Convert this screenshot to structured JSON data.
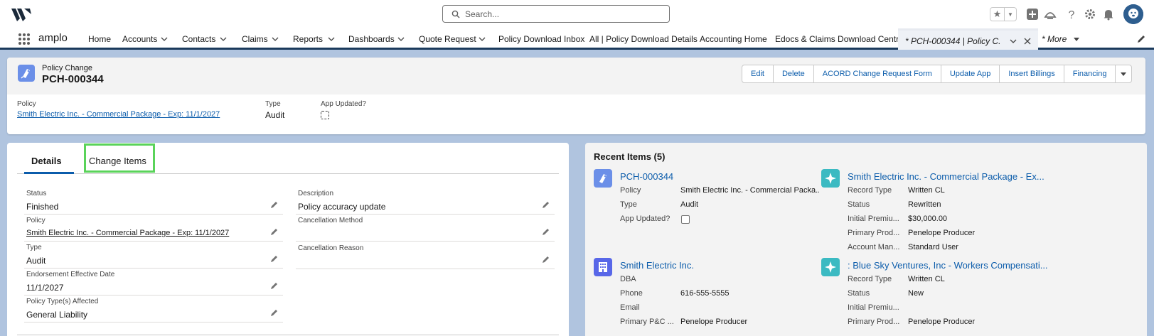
{
  "header": {
    "search_placeholder": "Search..."
  },
  "nav": {
    "app_name": "amplo",
    "items": [
      {
        "label": "Home"
      },
      {
        "label": "Accounts"
      },
      {
        "label": "Contacts"
      },
      {
        "label": "Claims"
      },
      {
        "label": "Reports"
      },
      {
        "label": "Dashboards"
      },
      {
        "label": "Quote Request"
      },
      {
        "label": "Policy Download Inbox"
      },
      {
        "label": "All | Policy Download Details"
      },
      {
        "label": "Accounting Home"
      },
      {
        "label": "Edocs & Claims Download Central"
      }
    ],
    "active_tab": "* PCH-000344 | Policy C...",
    "more_label": "* More"
  },
  "record": {
    "object_type": "Policy Change",
    "name": "PCH-000344",
    "buttons": [
      "Edit",
      "Delete",
      "ACORD Change Request Form",
      "Update App",
      "Insert Billings",
      "Financing"
    ],
    "highlights": {
      "policy_label": "Policy",
      "policy_value": "Smith Electric Inc. - Commercial Package - Exp: 11/1/2027",
      "type_label": "Type",
      "type_value": "Audit",
      "app_updated_label": "App Updated?"
    }
  },
  "tabs": {
    "details": "Details",
    "change_items": "Change Items"
  },
  "details": {
    "left": [
      {
        "label": "Status",
        "value": "Finished"
      },
      {
        "label": "Policy",
        "value": "Smith Electric Inc. - Commercial Package - Exp: 11/1/2027"
      },
      {
        "label": "Type",
        "value": "Audit"
      },
      {
        "label": "Endorsement Effective Date",
        "value": "11/1/2027"
      },
      {
        "label": "Policy Type(s) Affected",
        "value": "General Liability"
      }
    ],
    "right": [
      {
        "label": "Description",
        "value": "Policy accuracy update"
      },
      {
        "label": "Cancellation Method",
        "value": ""
      },
      {
        "label": "Cancellation Reason",
        "value": ""
      }
    ]
  },
  "recent": {
    "title": "Recent Items (5)",
    "items": [
      {
        "title": "PCH-000344",
        "fields": [
          {
            "label": "Policy",
            "value": "Smith Electric Inc. - Commercial Packa..."
          },
          {
            "label": "Type",
            "value": "Audit"
          },
          {
            "label": "App Updated?",
            "value": ""
          }
        ]
      },
      {
        "title": "Smith Electric Inc. - Commercial Package - Ex...",
        "fields": [
          {
            "label": "Record Type",
            "value": "Written CL"
          },
          {
            "label": "Status",
            "value": "Rewritten"
          },
          {
            "label": "Initial Premiu...",
            "value": "$30,000.00"
          },
          {
            "label": "Primary Prod...",
            "value": "Penelope Producer"
          },
          {
            "label": "Account Man...",
            "value": "Standard User"
          }
        ]
      },
      {
        "title": "Smith Electric Inc.",
        "fields": [
          {
            "label": "DBA",
            "value": ""
          },
          {
            "label": "Phone",
            "value": "616-555-5555"
          },
          {
            "label": "Email",
            "value": ""
          },
          {
            "label": "Primary P&C ...",
            "value": "Penelope Producer"
          }
        ]
      },
      {
        "title": ": Blue Sky Ventures, Inc - Workers Compensati...",
        "fields": [
          {
            "label": "Record Type",
            "value": "Written CL"
          },
          {
            "label": "Status",
            "value": "New"
          },
          {
            "label": "Initial Premiu...",
            "value": ""
          },
          {
            "label": "Primary Prod...",
            "value": "Penelope Producer"
          }
        ]
      }
    ]
  },
  "colors": {
    "brand_blue": "#0b5cab",
    "focus_green": "#5ad35a",
    "policy_change_icon": "#6b8fe8",
    "policy_icon": "#3bbac2",
    "account_icon": "#5867e8"
  }
}
